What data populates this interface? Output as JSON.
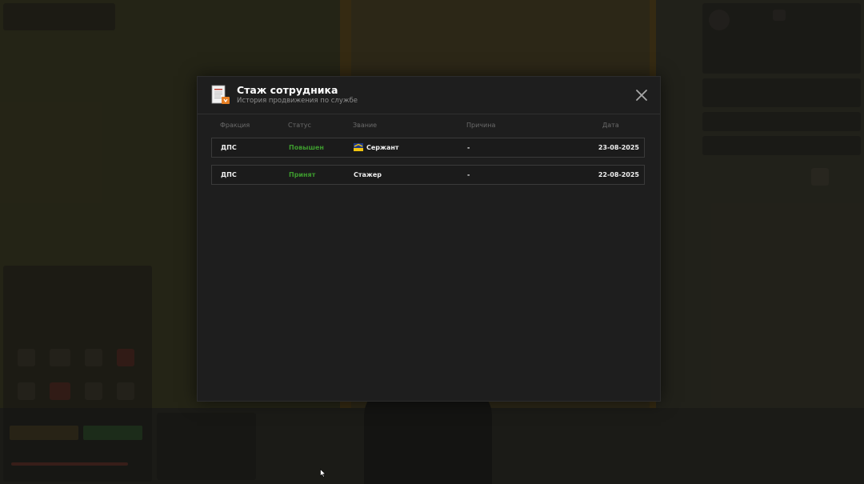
{
  "modal": {
    "title": "Стаж сотрудника",
    "subtitle": "История продвижения по службе",
    "icon": "document-icon",
    "close_icon": "close-icon"
  },
  "table": {
    "columns": [
      "Фракция",
      "Статус",
      "Звание",
      "Причина",
      "Дата"
    ],
    "rows": [
      {
        "faction": "ДПС",
        "status": "Повышен",
        "rank": "Сержант",
        "rank_icon": "sergeant-chevron-icon",
        "reason": "-",
        "date": "23-08-2025"
      },
      {
        "faction": "ДПС",
        "status": "Принят",
        "rank": "Стажер",
        "reason": "-",
        "date": "22-08-2025"
      }
    ]
  },
  "colors": {
    "status_green": "#3d9a2e",
    "modal_bg": "#1e1e1e",
    "row_border": "#3a3a3a"
  }
}
